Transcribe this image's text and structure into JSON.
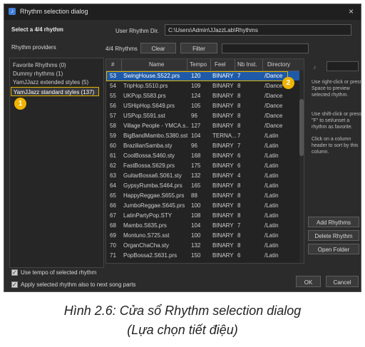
{
  "window": {
    "title": "Rhythm selection dialog",
    "close": "×",
    "app_icon_glyph": "♪"
  },
  "header": {
    "select_label": "Select a 4/4 rhythm",
    "user_dir_label": "User Rhythm Dir.",
    "user_dir_value": "C:\\Users\\Admin\\JJazzLab\\Rhythms"
  },
  "providers": {
    "label": "Rhythm providers",
    "items": [
      "Favorite Rhythms (0)",
      "Dummy rhythms (1)",
      "YamJJazz extended styles (5)",
      "YamJJazz standard styles (137)"
    ],
    "selected_index": 3
  },
  "toolbar": {
    "count_label": "4/4 Rhythms",
    "clear_label": "Clear",
    "filter_label": "Filter"
  },
  "table": {
    "columns": [
      "#",
      "Name",
      "Tempo",
      "Feel",
      "Nb Inst.",
      "Directory"
    ],
    "selected_index": 0,
    "rows": [
      [
        "53",
        "SwingHouse.S522.prs",
        "120",
        "BINARY",
        "7",
        "/Dance"
      ],
      [
        "54",
        "TripHop.S510.prs",
        "109",
        "BINARY",
        "8",
        "/Dance"
      ],
      [
        "55",
        "UKPop.S583.prs",
        "124",
        "BINARY",
        "8",
        "/Dance"
      ],
      [
        "56",
        "USHipHop.S649.prs",
        "105",
        "BINARY",
        "8",
        "/Dance"
      ],
      [
        "57",
        "USPop.S591.sst",
        "96",
        "BINARY",
        "8",
        "/Dance"
      ],
      [
        "58",
        "Village People - YMCA.s...",
        "127",
        "BINARY",
        "8",
        "/Dance"
      ],
      [
        "59",
        "BigBandMambo.S380.sst",
        "104",
        "TERNA...",
        "7",
        "/Latin"
      ],
      [
        "60",
        "BrazilianSamba.sty",
        "96",
        "BINARY",
        "7",
        "/Latin"
      ],
      [
        "61",
        "CoolBossa.S460.sty",
        "168",
        "BINARY",
        "6",
        "/Latin"
      ],
      [
        "62",
        "FastBossa.S629.prs",
        "175",
        "BINARY",
        "6",
        "/Latin"
      ],
      [
        "63",
        "GuitarBossa6.S061.sty",
        "132",
        "BINARY",
        "4",
        "/Latin"
      ],
      [
        "64",
        "GypsyRumba.S464.prs",
        "165",
        "BINARY",
        "8",
        "/Latin"
      ],
      [
        "65",
        "HappyReggae.S655.prs",
        "88",
        "BINARY",
        "8",
        "/Latin"
      ],
      [
        "66",
        "JumboReggae.S645.prs",
        "100",
        "BINARY",
        "8",
        "/Latin"
      ],
      [
        "67",
        "LatinPartyPop.STY",
        "108",
        "BINARY",
        "8",
        "/Latin"
      ],
      [
        "68",
        "Mambo.S635.prs",
        "104",
        "BINARY",
        "7",
        "/Latin"
      ],
      [
        "69",
        "Montuno.S725.sst",
        "100",
        "BINARY",
        "8",
        "/Latin"
      ],
      [
        "70",
        "OrganChaCha.sty",
        "132",
        "BINARY",
        "8",
        "/Latin"
      ],
      [
        "71",
        "PopBossa2.S631.prs",
        "150",
        "BINARY",
        "6",
        "/Latin"
      ]
    ]
  },
  "side": {
    "speaker_icon": "speaker-icon",
    "help": [
      "Use right-click or press Space to preview selected rhythm.",
      "Use shift-click or press \"F\" to set/unset a rhythm as favorite.",
      "Click on a column header to sort by this column."
    ],
    "add_label": "Add Rhythms",
    "delete_label": "Delete Rhythm",
    "open_label": "Open Folder"
  },
  "footer": {
    "use_tempo_label": "Use tempo of selected rhythm",
    "apply_label": "Apply selected rhythm also to next song parts",
    "ok_label": "OK",
    "cancel_label": "Cancel"
  },
  "annotations": {
    "badge1": "1",
    "badge2": "2"
  },
  "colors": {
    "highlight": "#e1b300",
    "selection": "#1e5aa8",
    "badge": "#f0b400"
  },
  "caption": {
    "line1": "Hình 2.6: Cửa sổ Rhythm selection dialog",
    "line2": "(Lựa chọn tiết điệu)"
  }
}
